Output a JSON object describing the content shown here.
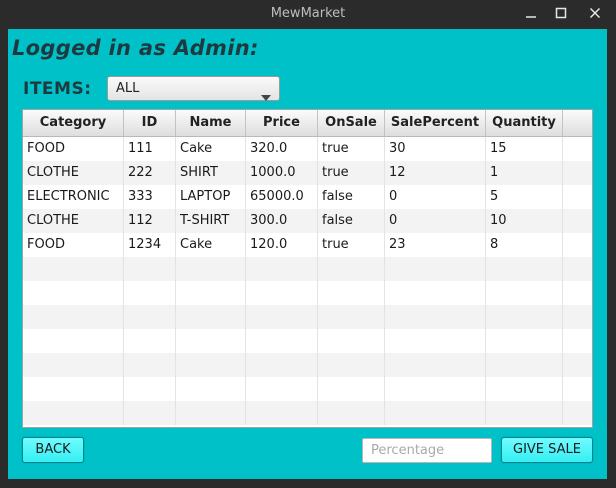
{
  "window": {
    "title": "MewMarket"
  },
  "heading": "Logged in as Admin:",
  "items_filter": {
    "label": "ITEMS:",
    "selected": "ALL"
  },
  "table": {
    "columns": [
      "Category",
      "ID",
      "Name",
      "Price",
      "OnSale",
      "SalePercent",
      "Quantity"
    ],
    "rows": [
      [
        "FOOD",
        "111",
        "Cake",
        "320.0",
        "true",
        "30",
        "15"
      ],
      [
        "CLOTHE",
        "222",
        "SHIRT",
        "1000.0",
        "true",
        "12",
        "1"
      ],
      [
        "ELECTRONIC",
        "333",
        "LAPTOP",
        "65000.0",
        "false",
        "0",
        "5"
      ],
      [
        "CLOTHE",
        "112",
        "T-SHIRT",
        "300.0",
        "false",
        "0",
        "10"
      ],
      [
        "FOOD",
        "1234",
        "Cake",
        "120.0",
        "true",
        "23",
        "8"
      ]
    ],
    "empty_rows": 7
  },
  "footer": {
    "back_label": "BACK",
    "percentage_placeholder": "Percentage",
    "percentage_value": "",
    "give_sale_label": "GIVE SALE"
  },
  "colors": {
    "background": "#00c1c8",
    "button": "#35eef3",
    "titlebar": "#2b2b2b"
  }
}
